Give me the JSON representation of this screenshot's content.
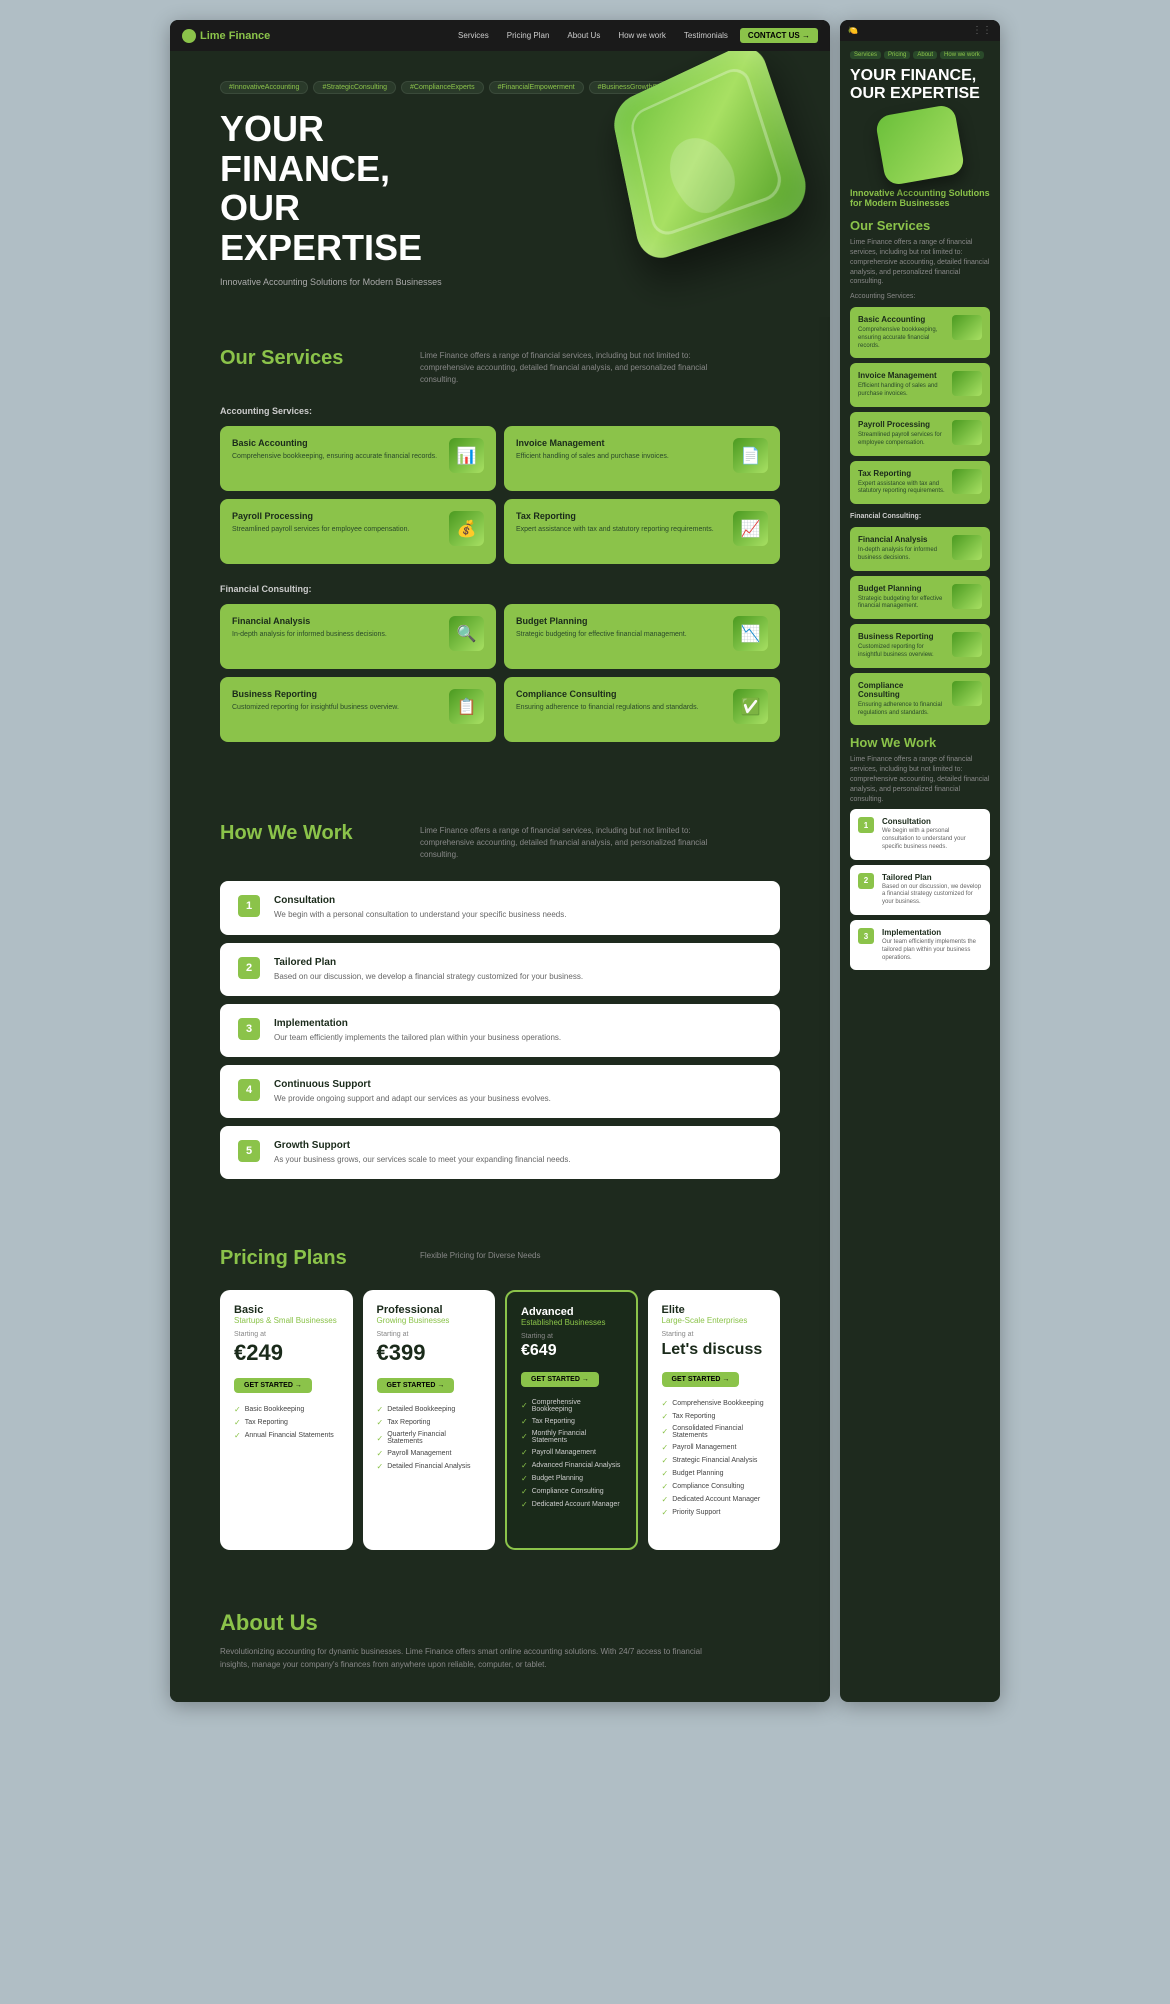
{
  "brand": {
    "name": "Lime Finance",
    "logo_text": "🍋 Lime Finance"
  },
  "nav": {
    "links": [
      "Services",
      "Pricing Plan",
      "About Us",
      "How we work",
      "Testimonials"
    ],
    "cta_label": "CONTACT US →"
  },
  "hero": {
    "tags": [
      "#InnovativeAccounting",
      "#StrategicConsulting",
      "#ComplianceExperts",
      "#FinancialEmpowerment",
      "#BusinessGrowthSupport"
    ],
    "title_line1": "YOUR",
    "title_line2": "FINANCE,",
    "title_line3": "OUR",
    "title_line4": "EXPERTISE",
    "subtitle": "Innovative Accounting Solutions for Modern Businesses"
  },
  "services": {
    "title": "Our Services",
    "description": "Lime Finance offers a range of financial services, including but not limited to: comprehensive accounting, detailed financial analysis, and personalized financial consulting.",
    "accounting_label": "Accounting Services:",
    "consulting_label": "Financial Consulting:",
    "cards": [
      {
        "title": "Basic Accounting",
        "desc": "Comprehensive bookkeeping, ensuring accurate financial records.",
        "icon": "📊"
      },
      {
        "title": "Invoice Management",
        "desc": "Efficient handling of sales and purchase invoices.",
        "icon": "📄"
      },
      {
        "title": "Payroll Processing",
        "desc": "Streamlined payroll services for employee compensation.",
        "icon": "💰"
      },
      {
        "title": "Tax Reporting",
        "desc": "Expert assistance with tax and statutory reporting requirements.",
        "icon": "📈"
      },
      {
        "title": "Financial Analysis",
        "desc": "In-depth analysis for informed business decisions.",
        "icon": "🔍"
      },
      {
        "title": "Budget Planning",
        "desc": "Strategic budgeting for effective financial management.",
        "icon": "📉"
      },
      {
        "title": "Business Reporting",
        "desc": "Customized reporting for insightful business overview.",
        "icon": "📋"
      },
      {
        "title": "Compliance Consulting",
        "desc": "Ensuring adherence to financial regulations and standards.",
        "icon": "✅"
      }
    ]
  },
  "how_we_work": {
    "title": "How We Work",
    "description": "Lime Finance offers a range of financial services, including but not limited to: comprehensive accounting, detailed financial analysis, and personalized financial consulting.",
    "steps": [
      {
        "number": "1",
        "title": "Consultation",
        "desc": "We begin with a personal consultation to understand your specific business needs."
      },
      {
        "number": "2",
        "title": "Tailored Plan",
        "desc": "Based on our discussion, we develop a financial strategy customized for your business."
      },
      {
        "number": "3",
        "title": "Implementation",
        "desc": "Our team efficiently implements the tailored plan within your business operations."
      },
      {
        "number": "4",
        "title": "Continuous Support",
        "desc": "We provide ongoing support and adapt our services as your business evolves."
      },
      {
        "number": "5",
        "title": "Growth Support",
        "desc": "As your business grows, our services scale to meet your expanding financial needs."
      }
    ]
  },
  "pricing": {
    "title": "Pricing Plans",
    "subtitle": "Flexible Pricing for Diverse Needs",
    "plans": [
      {
        "name": "Basic",
        "type": "Startups & Small Businesses",
        "starting_at": "Starting at",
        "price": "€249",
        "cta": "GET STARTED →",
        "featured": false,
        "features": [
          "Basic Bookkeeping",
          "Tax Reporting",
          "Annual Financial Statements"
        ]
      },
      {
        "name": "Professional",
        "type": "Growing Businesses",
        "starting_at": "Starting at",
        "price": "€399",
        "cta": "GET STARTED →",
        "featured": false,
        "features": [
          "Detailed Bookkeeping",
          "Tax Reporting",
          "Quarterly Financial Statements",
          "Payroll Management",
          "Detailed Financial Analysis"
        ]
      },
      {
        "name": "Advanced",
        "type": "Established Businesses",
        "starting_at": "Starting at",
        "price": "€649",
        "cta": "GET STARTED →",
        "featured": true,
        "features": [
          "Comprehensive Bookkeeping",
          "Tax Reporting",
          "Monthly Financial Statements",
          "Payroll Management",
          "Advanced Financial Analysis",
          "Budget Planning",
          "Compliance Consulting",
          "Dedicated Account Manager"
        ]
      },
      {
        "name": "Elite",
        "type": "Large-Scale Enterprises",
        "starting_at": "Starting at",
        "price_text": "Let's discuss",
        "cta": "GET STARTED →",
        "featured": false,
        "features": [
          "Comprehensive Bookkeeping",
          "Tax Reporting",
          "Consolidated Financial Statements",
          "Payroll Management",
          "Strategic Financial Analysis",
          "Budget Planning",
          "Compliance Consulting",
          "Dedicated Account Manager",
          "Priority Support"
        ]
      }
    ]
  },
  "about": {
    "title": "About Us",
    "desc": "Revolutionizing accounting for dynamic businesses. Lime Finance offers smart online accounting solutions. With 24/7 access to financial insights, manage your company's finances from anywhere upon reliable, computer, or tablet."
  },
  "sidebar": {
    "nav_tags": [
      "Services",
      "Pricing",
      "About",
      "How we work"
    ],
    "hero_title": "YOUR FINANCE, OUR EXPERTISE",
    "hero_subtitle": "Innovative Accounting Solutions for Modern Businesses",
    "services_title": "Our Services",
    "accounting_label": "Accounting Services:",
    "how_title": "How We Work"
  }
}
